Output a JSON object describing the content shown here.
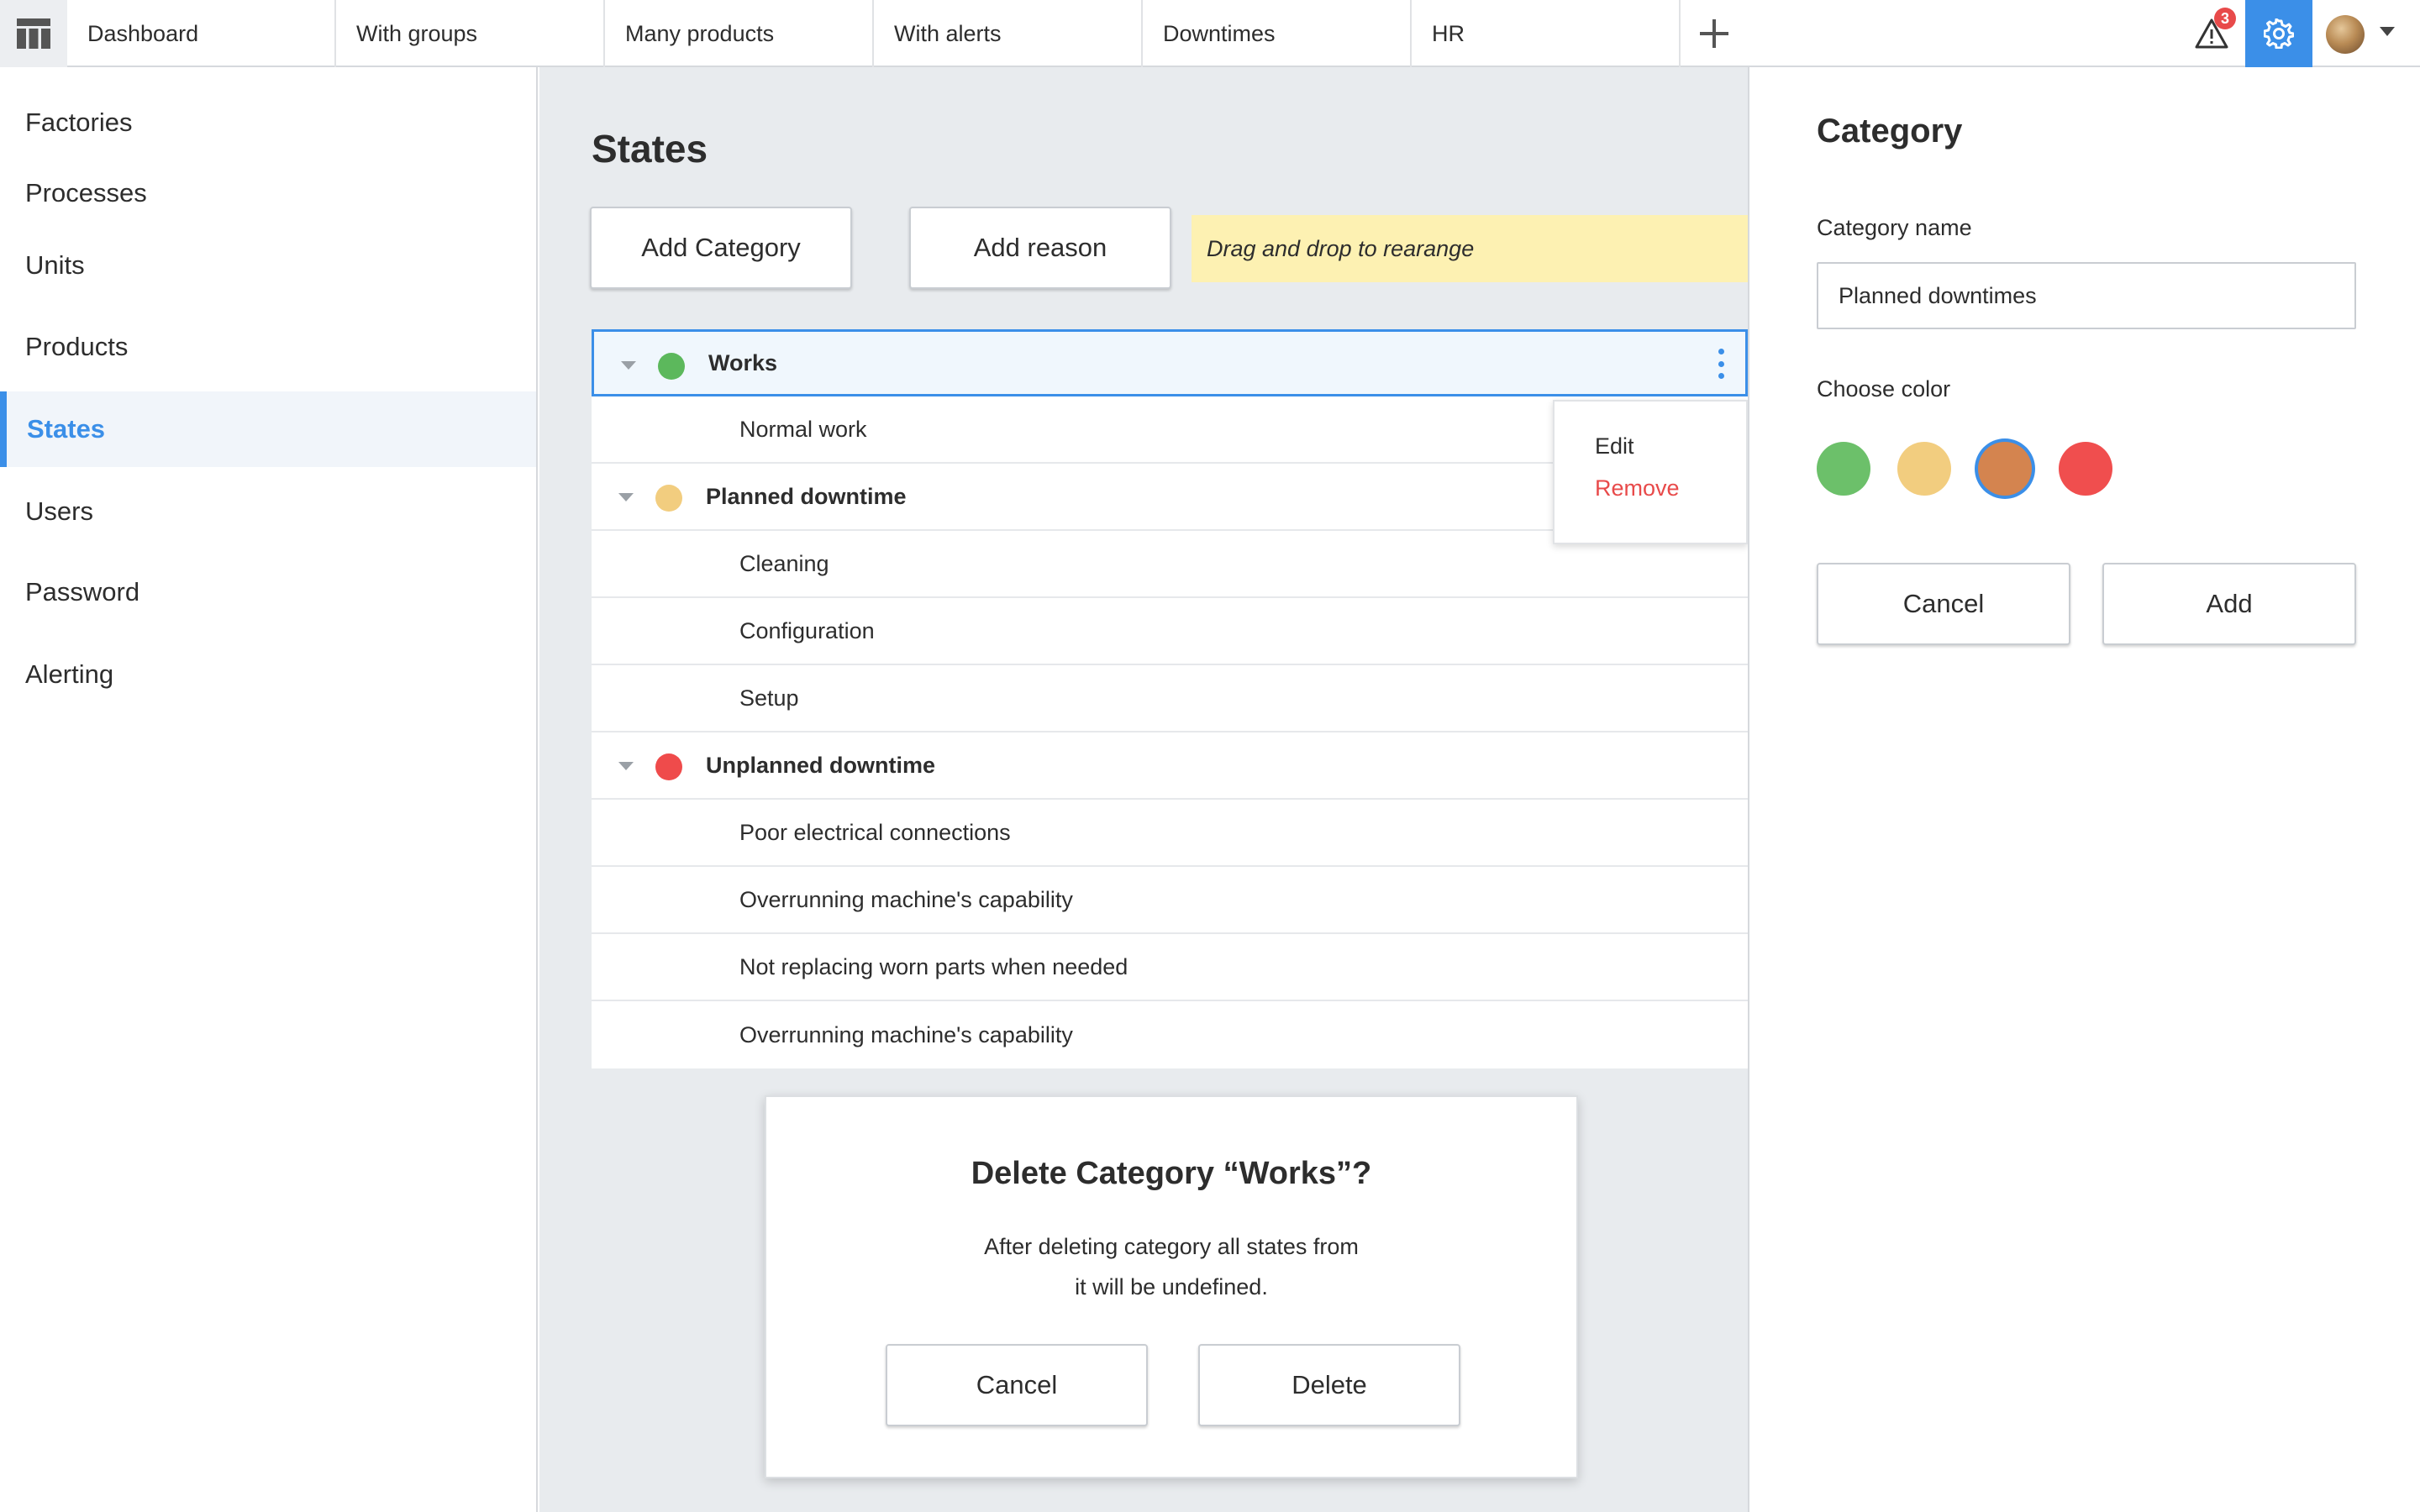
{
  "tabs": [
    "Dashboard",
    "With groups",
    "Many products",
    "With alerts",
    "Downtimes",
    "HR"
  ],
  "alerts": {
    "count": "3"
  },
  "sidebar": {
    "items": [
      "Factories",
      "Processes",
      "Units",
      "Products",
      "States",
      "Users",
      "Password",
      "Alerting"
    ],
    "active": "States"
  },
  "main": {
    "title": "States",
    "add_category_label": "Add Category",
    "add_reason_label": "Add reason",
    "hint": "Drag and drop to rearange"
  },
  "categories": [
    {
      "name": "Works",
      "color": "#5cb85c",
      "reasons": [
        "Normal work"
      ]
    },
    {
      "name": "Planned downtime",
      "color": "#f2cd7f",
      "reasons": [
        "Cleaning",
        "Configuration",
        "Setup"
      ]
    },
    {
      "name": "Unplanned downtime",
      "color": "#ef4b4b",
      "reasons": [
        "Poor electrical connections",
        "Overrunning machine's capability",
        "Not replacing worn parts when needed",
        "Overrunning machine's capability"
      ]
    }
  ],
  "context_menu": {
    "edit_label": "Edit",
    "remove_label": "Remove"
  },
  "dialog": {
    "title": "Delete Category “Works”?",
    "text_line1": "After deleting category all states from",
    "text_line2": "it will be undefined.",
    "cancel_label": "Cancel",
    "delete_label": "Delete"
  },
  "panel": {
    "title": "Category",
    "name_label": "Category name",
    "name_value": "Planned downtimes",
    "color_label": "Choose color",
    "colors": [
      "#6cc06a",
      "#f2cd7f",
      "#d4844f",
      "#f04e4e"
    ],
    "selected_color_index": 2,
    "cancel_label": "Cancel",
    "add_label": "Add"
  },
  "colors": {
    "accent": "#3b8fe8",
    "danger": "#e84a4a",
    "hint_bg": "#fdf1b2"
  }
}
